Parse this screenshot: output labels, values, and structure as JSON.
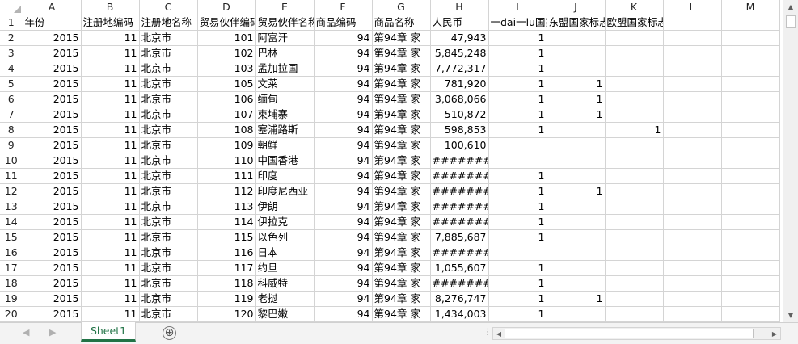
{
  "columns": [
    "A",
    "B",
    "C",
    "D",
    "E",
    "F",
    "G",
    "H",
    "I",
    "J",
    "K",
    "L",
    "M"
  ],
  "rows": [
    {
      "n": "1",
      "c": [
        "年份",
        "注册地编码",
        "注册地名称",
        "贸易伙伴编码",
        "贸易伙伴名称",
        "商品编码",
        "商品名称",
        "人民币",
        "一dai一lu国家标志",
        "东盟国家标志",
        "欧盟国家标志",
        "",
        ""
      ]
    },
    {
      "n": "2",
      "c": [
        "2015",
        "11",
        "北京市",
        "101",
        "阿富汗",
        "94",
        "第94章 家",
        "47,943",
        "1",
        "",
        "",
        "",
        ""
      ]
    },
    {
      "n": "3",
      "c": [
        "2015",
        "11",
        "北京市",
        "102",
        "巴林",
        "94",
        "第94章 家",
        "5,845,248",
        "1",
        "",
        "",
        "",
        ""
      ]
    },
    {
      "n": "4",
      "c": [
        "2015",
        "11",
        "北京市",
        "103",
        "孟加拉国",
        "94",
        "第94章 家",
        "7,772,317",
        "1",
        "",
        "",
        "",
        ""
      ]
    },
    {
      "n": "5",
      "c": [
        "2015",
        "11",
        "北京市",
        "105",
        "文莱",
        "94",
        "第94章 家",
        "781,920",
        "1",
        "1",
        "",
        "",
        ""
      ]
    },
    {
      "n": "6",
      "c": [
        "2015",
        "11",
        "北京市",
        "106",
        "缅甸",
        "94",
        "第94章 家",
        "3,068,066",
        "1",
        "1",
        "",
        "",
        ""
      ]
    },
    {
      "n": "7",
      "c": [
        "2015",
        "11",
        "北京市",
        "107",
        "柬埔寨",
        "94",
        "第94章 家",
        "510,872",
        "1",
        "1",
        "",
        "",
        ""
      ]
    },
    {
      "n": "8",
      "c": [
        "2015",
        "11",
        "北京市",
        "108",
        "塞浦路斯",
        "94",
        "第94章 家",
        "598,853",
        "1",
        "",
        "1",
        "",
        ""
      ]
    },
    {
      "n": "9",
      "c": [
        "2015",
        "11",
        "北京市",
        "109",
        "朝鲜",
        "94",
        "第94章 家",
        "100,610",
        "",
        "",
        "",
        "",
        ""
      ]
    },
    {
      "n": "10",
      "c": [
        "2015",
        "11",
        "北京市",
        "110",
        "中国香港",
        "94",
        "第94章 家",
        "#######",
        "",
        "",
        "",
        "",
        ""
      ]
    },
    {
      "n": "11",
      "c": [
        "2015",
        "11",
        "北京市",
        "111",
        "印度",
        "94",
        "第94章 家",
        "#######",
        "1",
        "",
        "",
        "",
        ""
      ]
    },
    {
      "n": "12",
      "c": [
        "2015",
        "11",
        "北京市",
        "112",
        "印度尼西亚",
        "94",
        "第94章 家",
        "#######",
        "1",
        "1",
        "",
        "",
        ""
      ]
    },
    {
      "n": "13",
      "c": [
        "2015",
        "11",
        "北京市",
        "113",
        "伊朗",
        "94",
        "第94章 家",
        "#######",
        "1",
        "",
        "",
        "",
        ""
      ]
    },
    {
      "n": "14",
      "c": [
        "2015",
        "11",
        "北京市",
        "114",
        "伊拉克",
        "94",
        "第94章 家",
        "#######",
        "1",
        "",
        "",
        "",
        ""
      ]
    },
    {
      "n": "15",
      "c": [
        "2015",
        "11",
        "北京市",
        "115",
        "以色列",
        "94",
        "第94章 家",
        "7,885,687",
        "1",
        "",
        "",
        "",
        ""
      ]
    },
    {
      "n": "16",
      "c": [
        "2015",
        "11",
        "北京市",
        "116",
        "日本",
        "94",
        "第94章 家",
        "#######",
        "",
        "",
        "",
        "",
        ""
      ]
    },
    {
      "n": "17",
      "c": [
        "2015",
        "11",
        "北京市",
        "117",
        "约旦",
        "94",
        "第94章 家",
        "1,055,607",
        "1",
        "",
        "",
        "",
        ""
      ]
    },
    {
      "n": "18",
      "c": [
        "2015",
        "11",
        "北京市",
        "118",
        "科威特",
        "94",
        "第94章 家",
        "#######",
        "1",
        "",
        "",
        "",
        ""
      ]
    },
    {
      "n": "19",
      "c": [
        "2015",
        "11",
        "北京市",
        "119",
        "老挝",
        "94",
        "第94章 家",
        "8,276,747",
        "1",
        "1",
        "",
        "",
        ""
      ]
    },
    {
      "n": "20",
      "c": [
        "2015",
        "11",
        "北京市",
        "120",
        "黎巴嫩",
        "94",
        "第94章 家",
        "1,434,003",
        "1",
        "",
        "",
        "",
        ""
      ]
    }
  ],
  "tabs": {
    "sheet1": "Sheet1",
    "add_symbol": "⊕",
    "prev_symbol": "◀",
    "next_symbol": "▶"
  },
  "icons": [
    "select-all-icon",
    "scroll-up-icon",
    "scroll-down-icon",
    "scroll-left-icon",
    "scroll-right-icon",
    "add-sheet-icon"
  ],
  "colors": {
    "accent": "#217346",
    "gridline": "#d4d4d4"
  }
}
